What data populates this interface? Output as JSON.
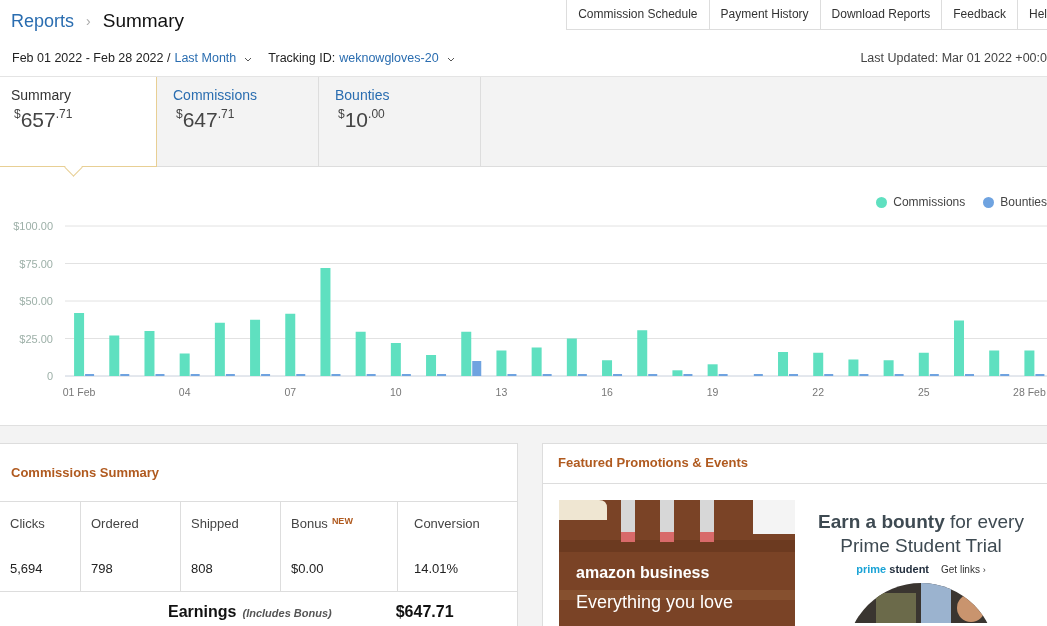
{
  "breadcrumb": {
    "parent": "Reports",
    "separator": "›",
    "current": "Summary"
  },
  "nav_links": [
    "Commission Schedule",
    "Payment History",
    "Download Reports",
    "Feedback",
    "Hel"
  ],
  "filters": {
    "date_range": "Feb 01 2022 - Feb 28 2022 /",
    "period": "Last Month",
    "tracking_label": "Tracking ID:",
    "tracking_id": "weknowgloves-20"
  },
  "last_updated": "Last Updated: Mar 01 2022 +00:0",
  "tabs": [
    {
      "label": "Summary",
      "currency": "$",
      "whole": "657",
      "cents": ".71",
      "selected": true
    },
    {
      "label": "Commissions",
      "currency": "$",
      "whole": "647",
      "cents": ".71",
      "selected": false
    },
    {
      "label": "Bounties",
      "currency": "$",
      "whole": "10",
      "cents": ".00",
      "selected": false
    }
  ],
  "chart_data": {
    "type": "bar",
    "x": [
      1,
      2,
      3,
      4,
      5,
      6,
      7,
      8,
      9,
      10,
      11,
      12,
      13,
      14,
      15,
      16,
      17,
      18,
      19,
      20,
      21,
      22,
      23,
      24,
      25,
      26,
      27,
      28
    ],
    "series": [
      {
        "name": "Commissions",
        "color": "#5fe0c0",
        "values": [
          42,
          27,
          30,
          15,
          35.5,
          37.5,
          41.5,
          72,
          29.5,
          22,
          14,
          29.5,
          17,
          19,
          25,
          10.5,
          30.5,
          3.8,
          7.8,
          0,
          16,
          15.5,
          11,
          10.5,
          15.5,
          37,
          17,
          17
        ]
      },
      {
        "name": "Bounties",
        "color": "#6fa3e0",
        "values": [
          0,
          0,
          0,
          0,
          0,
          0,
          0,
          0,
          0,
          0,
          0,
          10,
          0,
          0,
          0,
          0,
          0,
          0,
          0,
          0,
          0,
          0,
          0,
          0,
          0,
          0,
          0,
          0
        ]
      }
    ],
    "grid": true,
    "xlim": [
      0.6,
      28.5
    ],
    "ylim": [
      0,
      100
    ],
    "yticks": [
      {
        "value": 0,
        "label": "0"
      },
      {
        "value": 25,
        "label": "$25.00"
      },
      {
        "value": 50,
        "label": "$50.00"
      },
      {
        "value": 75,
        "label": "$75.00"
      },
      {
        "value": 100,
        "label": "$100.00"
      }
    ],
    "xticks": [
      {
        "value": 1,
        "label": "01 Feb"
      },
      {
        "value": 4,
        "label": "04"
      },
      {
        "value": 7,
        "label": "07"
      },
      {
        "value": 10,
        "label": "10"
      },
      {
        "value": 13,
        "label": "13"
      },
      {
        "value": 16,
        "label": "16"
      },
      {
        "value": 19,
        "label": "19"
      },
      {
        "value": 22,
        "label": "22"
      },
      {
        "value": 25,
        "label": "25"
      },
      {
        "value": 28,
        "label": "28 Feb"
      }
    ]
  },
  "commissions_summary": {
    "title": "Commissions Summary",
    "columns": [
      {
        "label": "Clicks",
        "value": "5,694"
      },
      {
        "label": "Ordered",
        "value": "798"
      },
      {
        "label": "Shipped",
        "value": "808"
      },
      {
        "label": "Bonus",
        "badge": "NEW",
        "value": "$0.00"
      },
      {
        "label": "Conversion",
        "value": "14.01%"
      }
    ],
    "earnings": {
      "label": "Earnings",
      "note": "(Includes Bonus)",
      "value": "$647.71"
    }
  },
  "promotions": {
    "title": "Featured Promotions & Events",
    "banner": {
      "brand": "amazon business",
      "tagline": "Everything you love"
    },
    "bounty": {
      "headline": "**Earn a bounty** for every Prime Student Trial",
      "logo_prime": "prime",
      "logo_student": "student",
      "link": "Get links",
      "link_arrow": "›"
    }
  }
}
